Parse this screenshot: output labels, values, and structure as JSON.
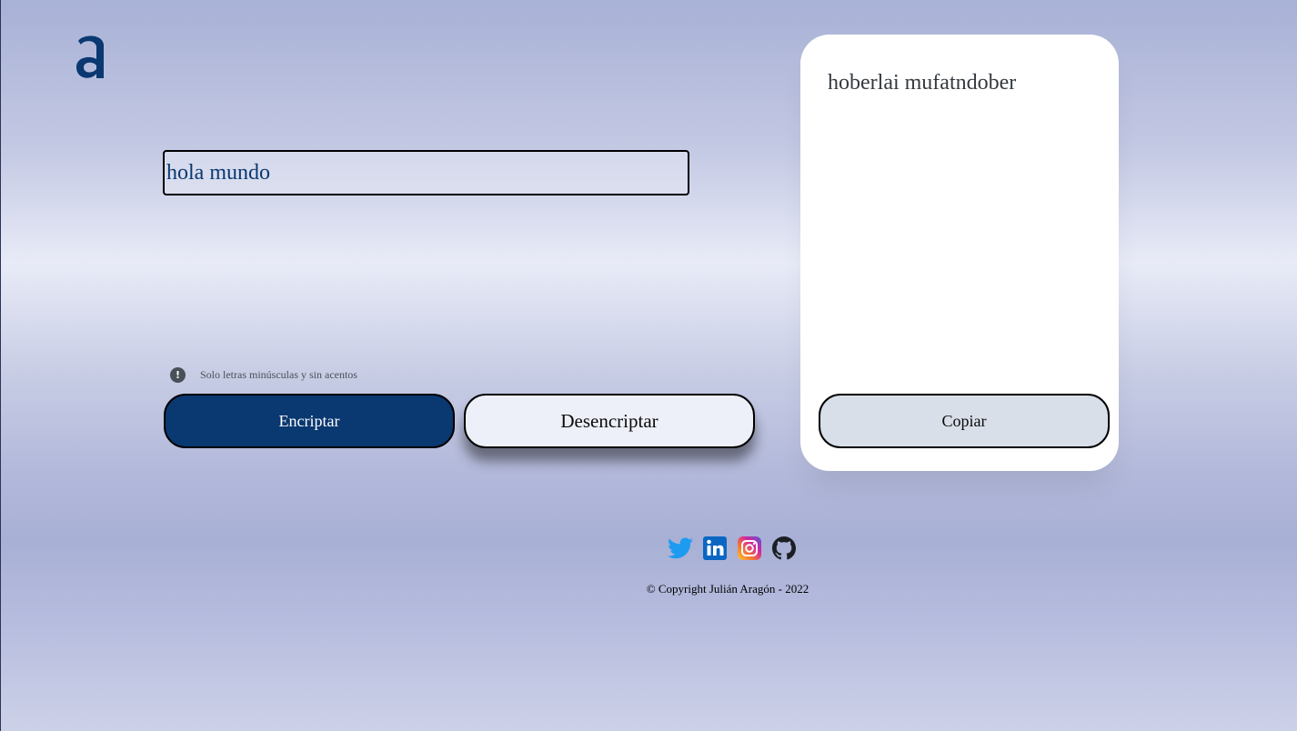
{
  "logo": {
    "icon": "alura-logo-icon",
    "color": "#0a3871"
  },
  "input": {
    "value": "hola mundo"
  },
  "hint": {
    "icon": "exclamation-circle-icon",
    "text": "Solo letras minúsculas y sin acentos"
  },
  "buttons": {
    "encrypt": "Encriptar",
    "decrypt": "Desencriptar",
    "copy": "Copiar"
  },
  "output": {
    "text": "hoberlai mufatndober"
  },
  "social": [
    {
      "name": "twitter-icon"
    },
    {
      "name": "linkedin-icon"
    },
    {
      "name": "instagram-icon"
    },
    {
      "name": "github-icon"
    }
  ],
  "footer": {
    "copyright": "© Copyright Julián Aragón - 2022"
  },
  "colors": {
    "accent": "#0a3871",
    "copy_button_bg": "#d8dfe8",
    "decrypt_button_bg": "#eef0f9"
  }
}
